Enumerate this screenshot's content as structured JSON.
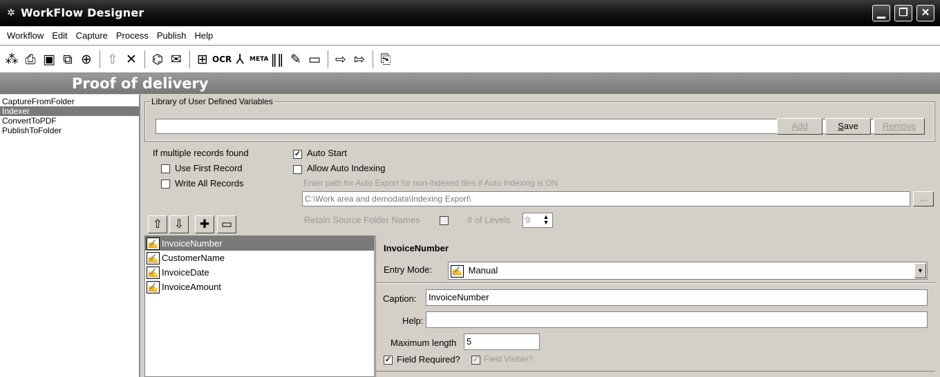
{
  "window": {
    "title": "WorkFlow Designer",
    "icon": "gear-icon"
  },
  "window_controls": {
    "minimize": "▁",
    "restore": "❐",
    "close": "✕"
  },
  "menu": [
    "Workflow",
    "Edit",
    "Capture",
    "Process",
    "Publish",
    "Help"
  ],
  "toolbar_icons": [
    "new-workflow-icon",
    "print-icon",
    "save-icon",
    "save-as-icon",
    "lock-icon",
    "upload-icon",
    "delete-icon",
    "capture-folder-icon",
    "capture-email-icon",
    "scan-icon",
    "ocr-icon",
    "pdf-icon",
    "meta-icon",
    "barcode-icon",
    "signature-icon",
    "comment-icon",
    "publish-icon",
    "publish-to-folder-icon",
    "preview-icon"
  ],
  "toolbar_labels": {
    "ocr": "OCR",
    "meta": "META"
  },
  "section": {
    "title": "Proof of delivery"
  },
  "steps": [
    "CaptureFromFolder",
    "Indexer",
    "ConvertToPDF",
    "PublishToFolder"
  ],
  "selected_step": 1,
  "library": {
    "legend": "Library of User Defined Variables",
    "value": "",
    "add": "Add",
    "save": "Save",
    "remove": "Remove"
  },
  "options": {
    "multiple_records_label": "If multiple records found",
    "use_first_record": "Use First Record",
    "write_all_records": "Write All Records",
    "auto_start": "Auto Start",
    "auto_start_checked": true,
    "allow_auto_indexing": "Allow Auto Indexing",
    "allow_auto_indexing_checked": false,
    "export_path_label": "Enter path for Auto Export for non-indexed files if Auto Indexing is ON",
    "export_path": "C:\\Work area and demodata\\Indexing Export\\",
    "browse": "...",
    "retain_label": "Retain Source Folder Names",
    "levels_label": "# of Levels",
    "levels_value": "9"
  },
  "field_buttons": {
    "up": "⇧",
    "down": "⇩",
    "add": "✚",
    "remove": "▭"
  },
  "fields": [
    "InvoiceNumber",
    "CustomerName",
    "InvoiceDate",
    "InvoiceAmount"
  ],
  "selected_field": 0,
  "properties": {
    "title": "InvoiceNumber",
    "entry_mode_label": "Entry Mode:",
    "entry_mode_value": "Manual",
    "caption_label": "Caption:",
    "caption_value": "InvoiceNumber",
    "help_label": "Help:",
    "help_value": "",
    "max_length_label": "Maximum length",
    "max_length_value": "5",
    "field_required": "Field Required?",
    "field_required_checked": true,
    "field_visible": "Field Visible?",
    "field_visible_checked": true
  }
}
